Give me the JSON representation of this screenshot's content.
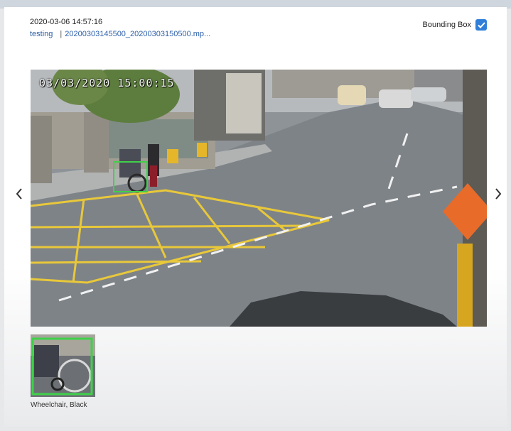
{
  "event": {
    "timestamp": "2020-03-06 14:57:16",
    "camera": "testing",
    "separator": "|",
    "filename": "20200303145500_20200303150500.mp..."
  },
  "bounding_box": {
    "label": "Bounding Box",
    "checked": true
  },
  "video": {
    "overlay_time": "03/03/2020 15:00:15"
  },
  "detections": [
    {
      "label": "Wheelchair, Black"
    }
  ],
  "navigation": {
    "prev_icon": "chevron-left-icon",
    "next_icon": "chevron-right-icon"
  },
  "colors": {
    "accent": "#2f7fd9",
    "link": "#2c5fa8",
    "bounding_box": "#3fd14a",
    "road_marking": "#e8c83a"
  }
}
